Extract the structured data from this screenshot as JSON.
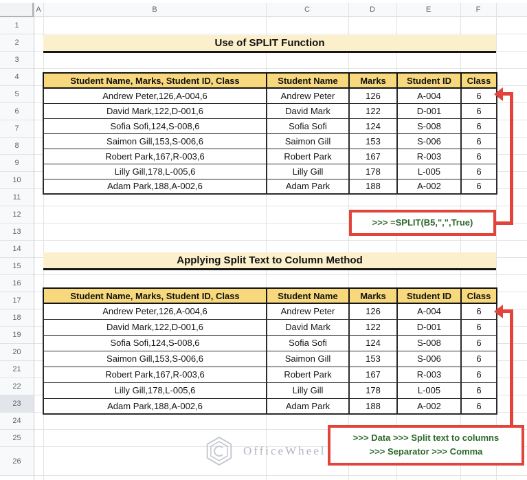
{
  "colors": {
    "accent_red": "#E2443C",
    "note_green": "#2D682D",
    "table_header_fill": "#F7D87C",
    "title_fill": "#FCF0CC"
  },
  "sheet": {
    "column_letters": [
      "A",
      "B",
      "C",
      "D",
      "E",
      "F"
    ],
    "row_count": 26,
    "selected_row": 23
  },
  "section1": {
    "title": "Use of SPLIT Function",
    "table": {
      "headers": [
        "Student Name, Marks, Student ID, Class",
        "Student Name",
        "Marks",
        "Student ID",
        "Class"
      ],
      "rows": [
        [
          "Andrew Peter,126,A-004,6",
          "Andrew Peter",
          "126",
          "A-004",
          "6"
        ],
        [
          "David Mark,122,D-001,6",
          "David Mark",
          "122",
          "D-001",
          "6"
        ],
        [
          "Sofia Sofi,124,S-008,6",
          "Sofia Sofi",
          "124",
          "S-008",
          "6"
        ],
        [
          "Saimon Gill,153,S-006,6",
          "Saimon Gill",
          "153",
          "S-006",
          "6"
        ],
        [
          "Robert Park,167,R-003,6",
          "Robert Park",
          "167",
          "R-003",
          "6"
        ],
        [
          "Lilly Gill,178,L-005,6",
          "Lilly Gill",
          "178",
          "L-005",
          "6"
        ],
        [
          "Adam Park,188,A-002,6",
          "Adam Park",
          "188",
          "A-002",
          "6"
        ]
      ]
    },
    "formula_note": ">>> =SPLIT(B5,\",\",True)"
  },
  "section2": {
    "title": "Applying Split Text to Column Method",
    "table": {
      "headers": [
        "Student Name, Marks, Student ID, Class",
        "Student Name",
        "Marks",
        "Student ID",
        "Class"
      ],
      "rows": [
        [
          "Andrew Peter,126,A-004,6",
          "Andrew Peter",
          "126",
          "A-004",
          "6"
        ],
        [
          "David Mark,122,D-001,6",
          "David Mark",
          "122",
          "D-001",
          "6"
        ],
        [
          "Sofia Sofi,124,S-008,6",
          "Sofia Sofi",
          "124",
          "S-008",
          "6"
        ],
        [
          "Saimon Gill,153,S-006,6",
          "Saimon Gill",
          "153",
          "S-006",
          "6"
        ],
        [
          "Robert Park,167,R-003,6",
          "Robert Park",
          "167",
          "R-003",
          "6"
        ],
        [
          "Lilly Gill,178,L-005,6",
          "Lilly Gill",
          "178",
          "L-005",
          "6"
        ],
        [
          "Adam Park,188,A-002,6",
          "Adam Park",
          "188",
          "A-002",
          "6"
        ]
      ]
    },
    "note": {
      "line1": ">>> Data >>> Split text to columns",
      "line2": ">>> Separator >>> Comma"
    }
  },
  "watermark": {
    "text": "OfficeWheel"
  }
}
